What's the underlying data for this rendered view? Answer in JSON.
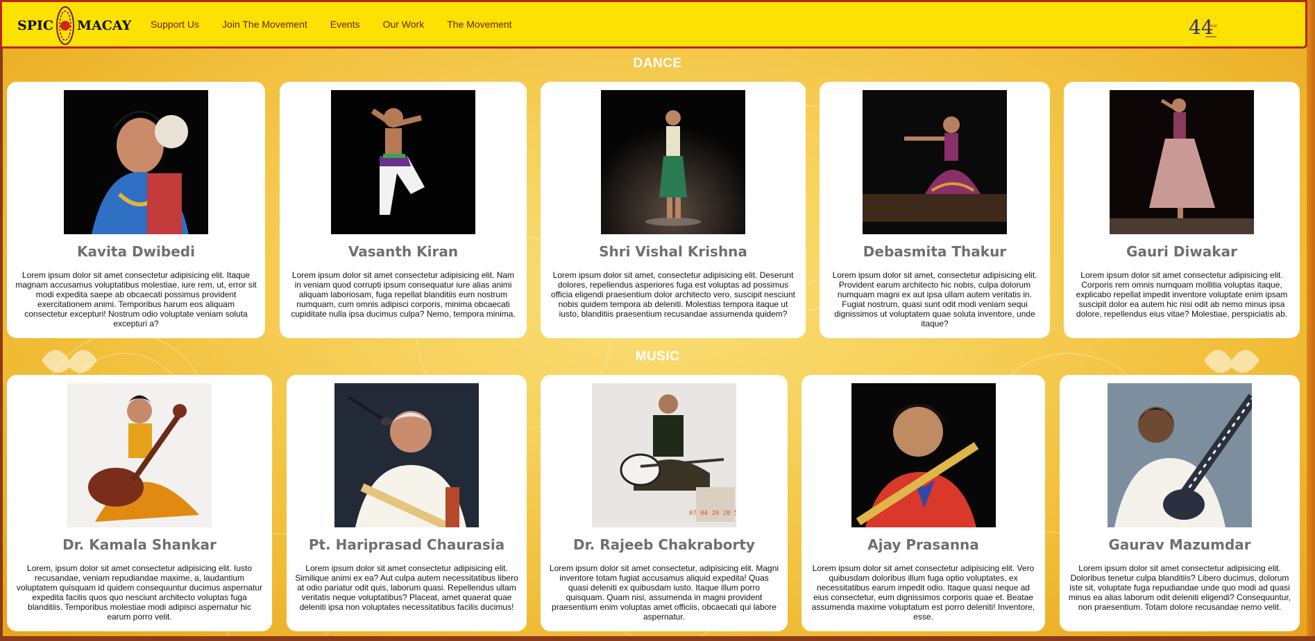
{
  "header": {
    "logo_left": "SPIC",
    "logo_right": "MACAY",
    "nav": [
      "Support Us",
      "Join The Movement",
      "Events",
      "Our Work",
      "The Movement"
    ],
    "anniversary_number": "44",
    "anniversary_word": "years"
  },
  "sections": {
    "dance_title": "DANCE",
    "music_title": "MUSIC"
  },
  "dance": [
    {
      "name": "Kavita Dwibedi",
      "desc": "Lorem ipsum dolor sit amet consectetur adipisicing elit. Itaque magnam accusamus voluptatibus molestiae, iure rem, ut, error sit modi expedita saepe ab obcaecati possimus provident exercitationem animi. Temporibus harum eos aliquam consectetur excepturi! Nostrum odio voluptate veniam soluta excepturi a?"
    },
    {
      "name": "Vasanth Kiran",
      "desc": "Lorem ipsum dolor sit amet consectetur adipisicing elit. Nam in veniam quod corrupti ipsum consequatur iure alias animi aliquam laboriosam, fuga repellat blanditiis eum nostrum numquam, cum omnis adipisci corporis, minima obcaecati cupiditate nulla ipsa ducimus culpa? Nemo, tempora minima."
    },
    {
      "name": "Shri Vishal Krishna",
      "desc": "Lorem ipsum dolor sit amet, consectetur adipisicing elit. Deserunt dolores, repellendus asperiores fuga est voluptas ad possimus officia eligendi praesentium dolor architecto vero, suscipit nesciunt nobis quidem tempora ab deleniti. Molestias tempora itaque ut iusto, blanditiis praesentium recusandae assumenda quidem?"
    },
    {
      "name": "Debasmita Thakur",
      "desc": "Lorem ipsum dolor sit amet, consectetur adipisicing elit. Provident earum architecto hic nobis, culpa dolorum numquam magni ex aut ipsa ullam autem veritatis in. Fugiat nostrum, quasi sunt odit modi veniam sequi dignissimos ut voluptatem quae soluta inventore, unde itaque?"
    },
    {
      "name": "Gauri Diwakar",
      "desc": "Lorem ipsum dolor sit amet consectetur adipisicing elit. Corporis rem omnis numquam mollitia voluptas itaque, explicabo repellat impedit inventore voluptate enim ipsam suscipit dolor ea autem hic nisi odit ab nemo minus ipsa dolore, repellendus eius vitae? Molestiae, perspiciatis ab."
    }
  ],
  "music": [
    {
      "name": "Dr. Kamala Shankar",
      "desc": "Lorem, ipsum dolor sit amet consectetur adipisicing elit. Iusto recusandae, veniam repudiandae maxime, a, laudantium voluptatem quisquam id quidem consequuntur ducimus aspernatur expedita facilis quos quo nesciunt architecto voluptas fuga blanditiis. Temporibus molestiae modi adipisci aspernatur hic earum porro velit."
    },
    {
      "name": "Pt. Hariprasad Chaurasia",
      "desc": "Lorem ipsum dolor sit amet consectetur adipisicing elit. Similique animi ex ea? Aut culpa autem necessitatibus libero at odio pariatur odit quis, laborum quasi. Repellendus ullam veritatis neque voluptatibus? Placeat, amet quaerat quae deleniti ipsa non voluptates necessitatibus facilis ducimus!"
    },
    {
      "name": "Dr. Rajeeb Chakraborty",
      "desc": "Lorem ipsum dolor sit amet consectetur, adipisicing elit. Magni inventore totam fugiat accusamus aliquid expedita! Quas quasi deleniti ex quibusdam iusto. Itaque illum porro quisquam. Quam nisi, assumenda in magni provident praesentium enim voluptas amet officiis, obcaecati qui labore aspernatur."
    },
    {
      "name": "Ajay Prasanna",
      "desc": "Lorem ipsum dolor sit amet consectetur adipisicing elit. Vero quibusdam doloribus illum fuga optio voluptates, ex necessitatibus earum impedit odio. Itaque quasi neque ad eius consectetur, eum dignissimos corporis quae et. Beatae assumenda maxime voluptatum est porro deleniti! Inventore, esse."
    },
    {
      "name": "Gaurav Mazumdar",
      "desc": "Lorem ipsum dolor sit amet consectetur adipisicing elit. Doloribus tenetur culpa blanditiis? Libero ducimus, dolorum iste sit, voluptate fuga repudiandae unde quo modi ad quasi minus ea alias laborum odit deleniti eligendi? Consequuntur, non praesentium. Totam dolore recusandae nemo velit."
    }
  ],
  "colors": {
    "header_bg": "#fde100",
    "header_border": "#b3261e",
    "nav_text": "#6b1f12",
    "page_bg": "#f6cf57",
    "card_bg": "#ffffff",
    "name_text": "#6f6f6f"
  }
}
